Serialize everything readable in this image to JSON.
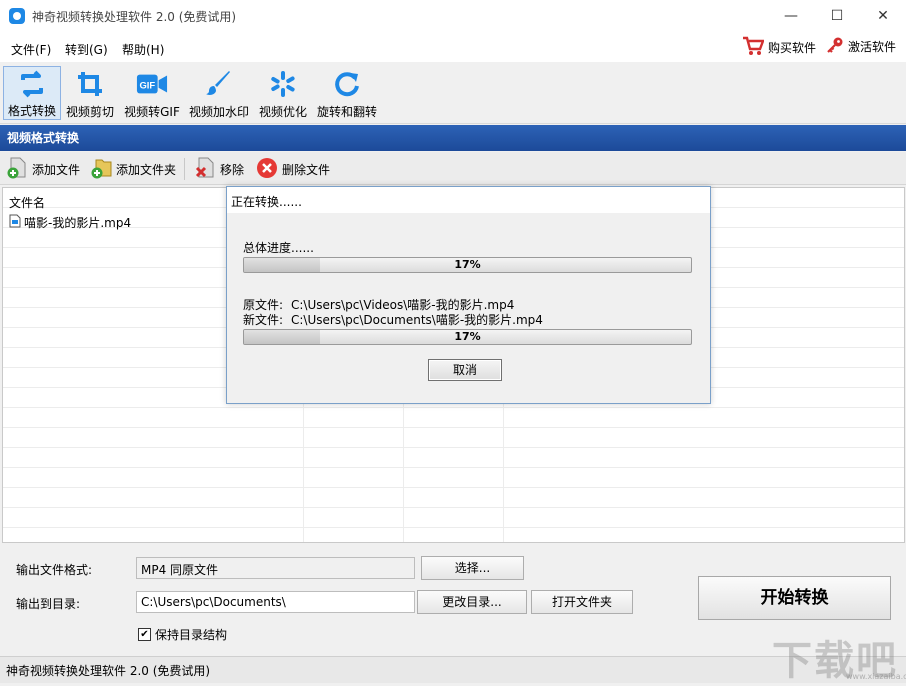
{
  "window": {
    "title": "神奇视频转换处理软件 2.0 (免费试用)",
    "minimize": "—",
    "maximize": "☐",
    "close": "✕"
  },
  "menu": {
    "file": "文件(F)",
    "goto": "转到(G)",
    "help": "帮助(H)",
    "buy": "购买软件",
    "activate": "激活软件"
  },
  "tools": [
    {
      "label": "格式转换",
      "icon": "format-convert-icon"
    },
    {
      "label": "视频剪切",
      "icon": "crop-icon"
    },
    {
      "label": "视频转GIF",
      "icon": "gif-icon"
    },
    {
      "label": "视频加水印",
      "icon": "brush-icon"
    },
    {
      "label": "视频优化",
      "icon": "optimize-icon"
    },
    {
      "label": "旋转和翻转",
      "icon": "rotate-icon"
    }
  ],
  "section": {
    "title": "视频格式转换"
  },
  "file_toolbar": {
    "add_file": "添加文件",
    "add_folder": "添加文件夹",
    "remove": "移除",
    "delete": "删除文件"
  },
  "list": {
    "column_name": "文件名",
    "files": [
      "喵影-我的影片.mp4"
    ]
  },
  "dialog": {
    "title": "正在转换......",
    "overall_label": "总体进度......",
    "overall_progress": 17,
    "overall_pct": "17%",
    "source_label": "原文件:",
    "source_path": "C:\\Users\\pc\\Videos\\喵影-我的影片.mp4",
    "target_label": "新文件:",
    "target_path": "C:\\Users\\pc\\Documents\\喵影-我的影片.mp4",
    "file_progress": 17,
    "file_pct": "17%",
    "cancel": "取消"
  },
  "output": {
    "format_label": "输出文件格式:",
    "format_value": "MP4 同原文件",
    "choose": "选择...",
    "dir_label": "输出到目录:",
    "dir_value": "C:\\Users\\pc\\Documents\\",
    "change_dir": "更改目录...",
    "open_folder": "打开文件夹",
    "keep_structure": "保持目录结构",
    "keep_checked": true,
    "start": "开始转换"
  },
  "status": {
    "text": "神奇视频转换处理软件 2.0 (免费试用)"
  },
  "watermark": {
    "text": "下载吧",
    "sub": "www.xiazaiba.com"
  },
  "colors": {
    "accent": "#2d62b6",
    "icon_blue": "#1e88e5",
    "cart_red": "#d32f2f"
  }
}
